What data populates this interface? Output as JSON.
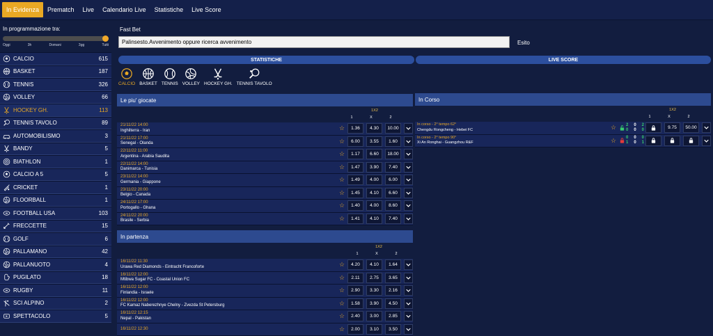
{
  "nav": [
    {
      "label": "In Evidenza",
      "active": true
    },
    {
      "label": "Prematch"
    },
    {
      "label": "Live"
    },
    {
      "label": "Calendario Live"
    },
    {
      "label": "Statistiche"
    },
    {
      "label": "Live Score"
    }
  ],
  "schedule": {
    "title": "In programmazione tra:",
    "labels": [
      "Oggi",
      "3h",
      "Domani",
      "3gg",
      "Tutti"
    ],
    "level": 1.0
  },
  "sports": [
    {
      "name": "CALCIO",
      "count": "615",
      "icon": "soccer-ball-icon"
    },
    {
      "name": "BASKET",
      "count": "187",
      "icon": "basketball-icon"
    },
    {
      "name": "TENNIS",
      "count": "326",
      "icon": "tennis-ball-icon"
    },
    {
      "name": "VOLLEY",
      "count": "66",
      "icon": "volleyball-icon"
    },
    {
      "name": "HOCKEY GH.",
      "count": "113",
      "icon": "hockey-sticks-icon",
      "active": true
    },
    {
      "name": "TENNIS TAVOLO",
      "count": "89",
      "icon": "table-tennis-icon"
    },
    {
      "name": "AUTOMOBILISMO",
      "count": "3",
      "icon": "car-icon"
    },
    {
      "name": "BANDY",
      "count": "5",
      "icon": "bandy-sticks-icon"
    },
    {
      "name": "BIATHLON",
      "count": "1",
      "icon": "biathlon-target-icon"
    },
    {
      "name": "CALCIO A 5",
      "count": "5",
      "icon": "futsal-ball-icon"
    },
    {
      "name": "CRICKET",
      "count": "1",
      "icon": "cricket-bat-icon"
    },
    {
      "name": "FLOORBALL",
      "count": "1",
      "icon": "floorball-icon"
    },
    {
      "name": "FOOTBALL USA",
      "count": "103",
      "icon": "american-football-icon"
    },
    {
      "name": "FRECCETTE",
      "count": "15",
      "icon": "darts-icon"
    },
    {
      "name": "GOLF",
      "count": "6",
      "icon": "golf-ball-icon"
    },
    {
      "name": "PALLAMANO",
      "count": "42",
      "icon": "handball-icon"
    },
    {
      "name": "PALLANUOTO",
      "count": "4",
      "icon": "water-polo-icon"
    },
    {
      "name": "PUGILATO",
      "count": "18",
      "icon": "boxing-glove-icon"
    },
    {
      "name": "RUGBY",
      "count": "11",
      "icon": "rugby-ball-icon"
    },
    {
      "name": "SCI ALPINO",
      "count": "2",
      "icon": "ski-icon"
    },
    {
      "name": "SPETTACOLO",
      "count": "5",
      "icon": "entertainment-icon"
    }
  ],
  "fastbet": {
    "title": "Fast Bet",
    "placeholder": "Palinsesto.Avvenimento oppure ricerca avvenimento",
    "esito": "Esito"
  },
  "tabs": {
    "stat": "STATISTICHE",
    "live": "LIVE SCORE"
  },
  "sport_icons": [
    {
      "label": "CALCIO",
      "icon": "soccer-ball-icon",
      "active": true
    },
    {
      "label": "BASKET",
      "icon": "basketball-icon"
    },
    {
      "label": "TENNIS",
      "icon": "tennis-ball-icon"
    },
    {
      "label": "VOLLEY",
      "icon": "volleyball-icon"
    },
    {
      "label": "HOCKEY GH.",
      "icon": "hockey-sticks-icon"
    },
    {
      "label": "TENNIS TAVOLO",
      "icon": "table-tennis-icon"
    }
  ],
  "markets": {
    "group": "1X2",
    "c1": "1",
    "cx": "X",
    "c2": "2"
  },
  "popular": {
    "title": "Le piu' giocate",
    "rows": [
      {
        "date": "21/11/22 14:00",
        "teams": "Inghilterra - Iran",
        "o1": "1.36",
        "ox": "4.30",
        "o2": "10.00"
      },
      {
        "date": "21/11/22 17:00",
        "teams": "Senegal - Olanda",
        "o1": "6.00",
        "ox": "3.55",
        "o2": "1.60"
      },
      {
        "date": "22/11/22 11:00",
        "teams": "Argentina - Arabia Saudita",
        "o1": "1.17",
        "ox": "6.60",
        "o2": "18.00"
      },
      {
        "date": "22/11/22 14:00",
        "teams": "Danimarca - Tunisia",
        "o1": "1.47",
        "ox": "3.90",
        "o2": "7.40"
      },
      {
        "date": "23/11/22 14:00",
        "teams": "Germania - Giappone",
        "o1": "1.49",
        "ox": "4.00",
        "o2": "6.00"
      },
      {
        "date": "23/11/22 20:00",
        "teams": "Belgio - Canada",
        "o1": "1.45",
        "ox": "4.10",
        "o2": "6.60"
      },
      {
        "date": "24/11/22 17:00",
        "teams": "Portogallo - Ghana",
        "o1": "1.40",
        "ox": "4.00",
        "o2": "8.60"
      },
      {
        "date": "24/11/22 20:00",
        "teams": "Brasile - Serbia",
        "o1": "1.41",
        "ox": "4.10",
        "o2": "7.40"
      }
    ]
  },
  "starting": {
    "title": "In partenza",
    "rows": [
      {
        "date": "16/11/22 11:30",
        "teams": "Urawa Red Diamonds - Eintracht Francoforte",
        "o1": "4.20",
        "ox": "4.10",
        "o2": "1.64"
      },
      {
        "date": "16/11/22 12:00",
        "teams": "Mtibwa Sugar FC - Coastal Union FC",
        "o1": "2.11",
        "ox": "2.75",
        "o2": "3.65"
      },
      {
        "date": "16/11/22 12:00",
        "teams": "Finlandia - Israele",
        "o1": "2.90",
        "ox": "3.30",
        "o2": "2.16"
      },
      {
        "date": "16/11/22 12:00",
        "teams": "FC Kamaz Naberezhnye Chelny - Zvezda St Petersburg",
        "o1": "1.58",
        "ox": "3.90",
        "o2": "4.50"
      },
      {
        "date": "16/11/22 12:15",
        "teams": "Nepal - Pakistan",
        "o1": "2.40",
        "ox": "3.00",
        "o2": "2.85"
      },
      {
        "date": "16/11/22 12:30",
        "teams": "",
        "o1": "2.00",
        "ox": "3.10",
        "o2": "3.50"
      }
    ]
  },
  "incorso": {
    "title": "In Corso",
    "rows": [
      {
        "status": "In corso - 2° tempo 62°",
        "teams": "Chengdu Rongcheng - Hebei FC",
        "lock": "open",
        "s1": [
          "2",
          "0",
          "2"
        ],
        "s2": [
          "0",
          "0",
          "0"
        ],
        "o2x": "9.75",
        "o22": "50.00"
      },
      {
        "status": "In corso - 2° tempo 90°",
        "teams": "Xi An Ronghai - Guangzhou R&F",
        "lock": "closed",
        "s1": [
          "0",
          "0",
          "0"
        ],
        "s2": [
          "1",
          "0",
          "1"
        ]
      }
    ]
  },
  "colors": {
    "accent": "#e9a824",
    "header": "#2d4a8f",
    "bg": "#121d3f",
    "row": "#18265a",
    "green": "#37c96e",
    "red": "#e23b3b"
  }
}
